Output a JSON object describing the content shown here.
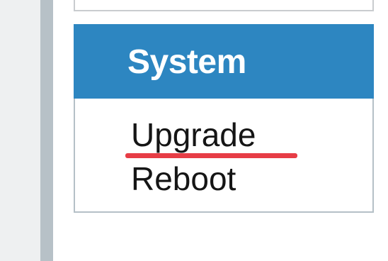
{
  "sidebar": {
    "system_heading": "System",
    "items": [
      {
        "label": "Upgrade",
        "active": true
      },
      {
        "label": "Reboot",
        "active": false
      }
    ]
  },
  "theme": {
    "header_background": "#2d86c1",
    "active_indicator": "#e73d46",
    "left_rule": "#b7c1c7",
    "panel_border": "#b5c0c7"
  }
}
